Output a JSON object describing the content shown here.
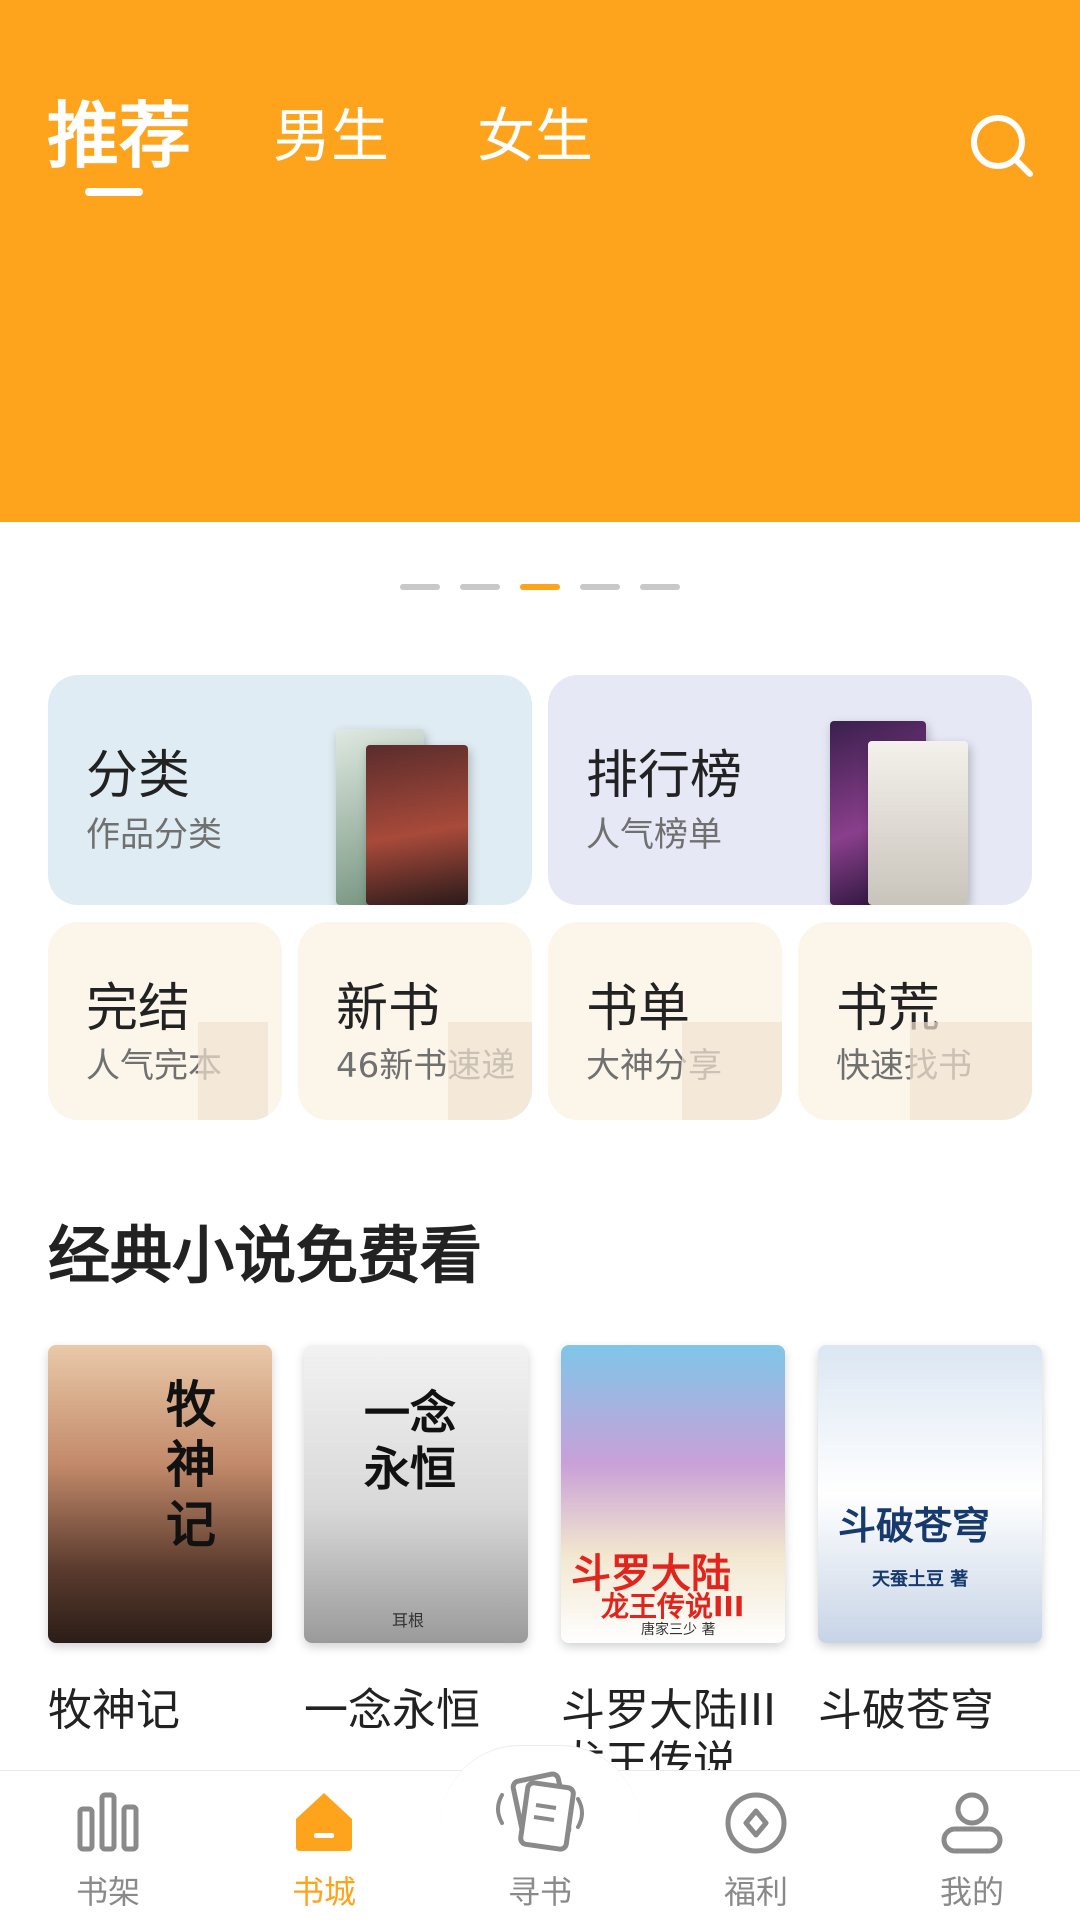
{
  "colors": {
    "accent": "#FEA31C",
    "header_bg": "#FEA31C",
    "nav_inactive": "#8a8a8a",
    "category_card_bg": "#E0ECF3",
    "ranking_card_bg": "#E6E9F5",
    "small_card_bg": "#FBF5EA"
  },
  "header": {
    "tabs": [
      {
        "label": "推荐",
        "active": true
      },
      {
        "label": "男生",
        "active": false
      },
      {
        "label": "女生",
        "active": false
      }
    ],
    "search_icon": "search-icon"
  },
  "banner": {
    "page_count": 5,
    "active_page": 3
  },
  "entries": {
    "category": {
      "title": "分类",
      "subtitle": "作品分类"
    },
    "ranking": {
      "title": "排行榜",
      "subtitle": "人气榜单"
    },
    "small": [
      {
        "title": "完结",
        "subtitle": "人气完本"
      },
      {
        "title": "新书",
        "subtitle": "46新书速递"
      },
      {
        "title": "书单",
        "subtitle": "大神分享"
      },
      {
        "title": "书荒",
        "subtitle": "快速找书"
      }
    ]
  },
  "section": {
    "title": "经典小说免费看",
    "books": [
      {
        "name": "牧神记",
        "cover_text": "牧神记"
      },
      {
        "name": "一念永恒",
        "cover_text": "一念永恒",
        "cover_author": "耳根"
      },
      {
        "name": "斗罗大陆III龙王传说",
        "cover_text": "斗罗大陆",
        "cover_text2": "龙王传说III",
        "cover_author": "唐家三少 著"
      },
      {
        "name": "斗破苍穹",
        "cover_text": "斗破苍穹",
        "cover_author": "天蚕土豆 著"
      }
    ]
  },
  "bottom_nav": [
    {
      "label": "书架",
      "icon": "bookshelf-icon",
      "active": false
    },
    {
      "label": "书城",
      "icon": "bookstore-home-icon",
      "active": true
    },
    {
      "label": "寻书",
      "icon": "find-book-icon",
      "active": false
    },
    {
      "label": "福利",
      "icon": "coin-welfare-icon",
      "active": false
    },
    {
      "label": "我的",
      "icon": "profile-icon",
      "active": false
    }
  ]
}
